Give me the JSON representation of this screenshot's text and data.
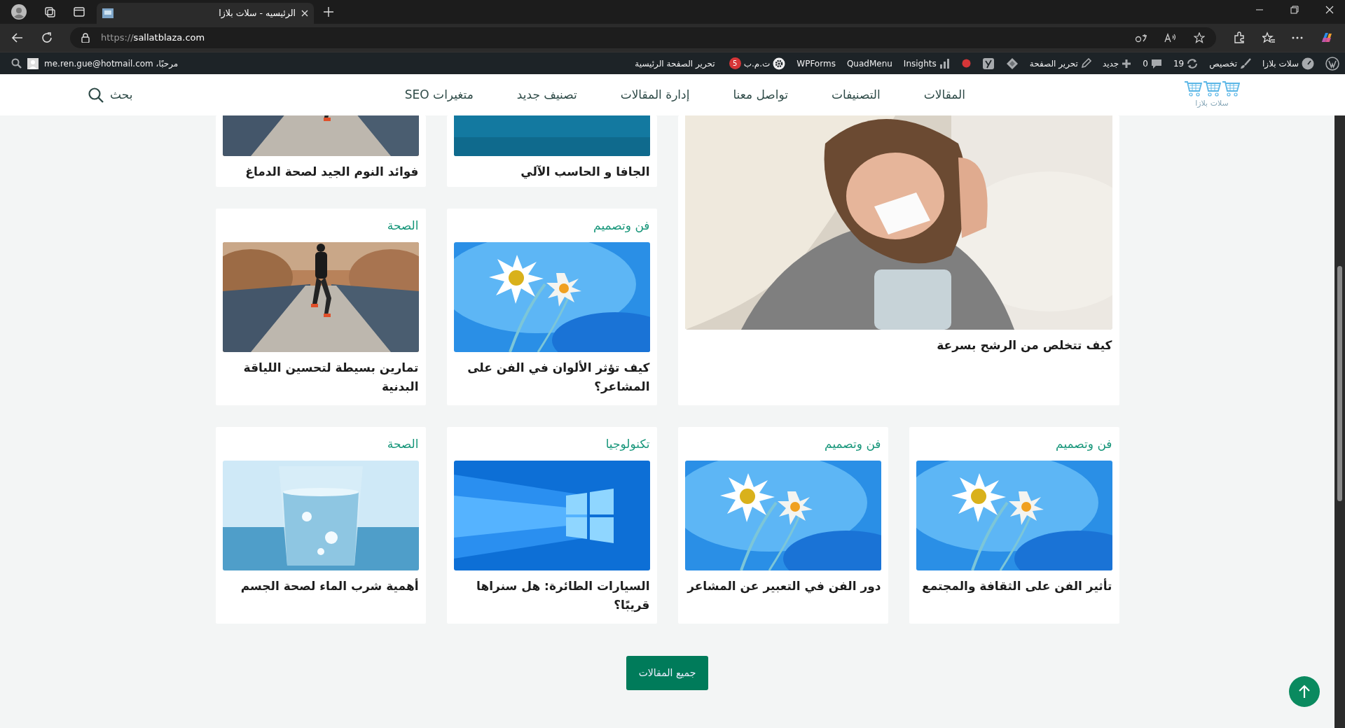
{
  "browser": {
    "tabs": [
      {
        "title": "الرئيسيه - سلات بلازا",
        "selected": true
      }
    ],
    "url_scheme": "https://",
    "url_host": "sallatblaza.com"
  },
  "admin_bar": {
    "items": [
      {
        "kind": "icon"
      },
      {
        "kind": "link",
        "label": "سلات بلازا"
      },
      {
        "kind": "link",
        "label": "تخصيص"
      },
      {
        "kind": "link",
        "label": "19"
      },
      {
        "kind": "link",
        "label": "0"
      },
      {
        "kind": "link",
        "label": "جديد"
      },
      {
        "kind": "link",
        "label": "تحرير الصفحة"
      },
      {
        "kind": "icon"
      },
      {
        "kind": "icon"
      },
      {
        "kind": "icon"
      },
      {
        "kind": "link",
        "label": "Insights"
      },
      {
        "kind": "link",
        "label": "QuadMenu"
      },
      {
        "kind": "link",
        "label": "WPForms"
      },
      {
        "kind": "link",
        "label": "ت.م.ب",
        "badge": "5"
      },
      {
        "kind": "link",
        "label": "تحرير الصفحة الرئيسية"
      }
    ],
    "greeting": "مرحبًا، me.ren.gue@hotmail.com"
  },
  "site_nav": {
    "logo_text": "سلات بلازا",
    "menu": [
      "المقالات",
      "التصنيفات",
      "تواصل معنا",
      "إدارة المقالات",
      "تصنيف جديد",
      "متغيرات SEO"
    ],
    "search_label": "بحث"
  },
  "posts": [
    {
      "kind": "featured",
      "title": "كيف تتخلص من الرشح بسرعة"
    },
    {
      "kind": "cut",
      "title": "الجافا و الحاسب الآلي"
    },
    {
      "kind": "cut",
      "title": "فوائد النوم الجيد لصحة الدماغ"
    },
    {
      "kind": "card",
      "category": "فن وتصميم",
      "title": "كيف تؤثر الألوان في الفن على المشاعر؟"
    },
    {
      "kind": "card",
      "category": "الصحة",
      "title": "تمارين بسيطة لتحسين اللياقة البدنية"
    },
    {
      "kind": "card",
      "category": "فن وتصميم",
      "title": "تأثير الفن على الثقافة والمجتمع"
    },
    {
      "kind": "card",
      "category": "فن وتصميم",
      "title": "دور الفن في التعبير عن المشاعر"
    },
    {
      "kind": "card",
      "category": "تكنولوجيا",
      "title": "السيارات الطائرة: هل سنراها قريبًا؟"
    },
    {
      "kind": "card",
      "category": "الصحة",
      "title": "أهمية شرب الماء لصحة الجسم"
    }
  ],
  "all_posts_button": "جميع المقالات"
}
